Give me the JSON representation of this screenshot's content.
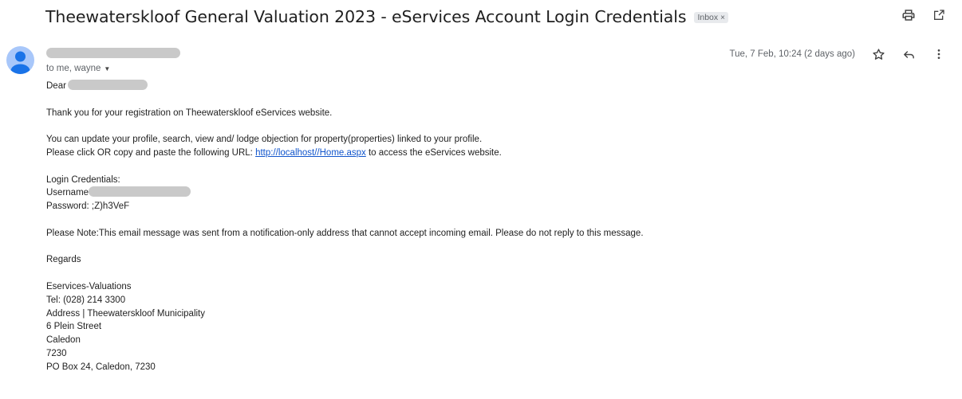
{
  "email": {
    "subject": "Theewaterskloof General Valuation 2023 - eServices Account Login Credentials",
    "label": "Inbox",
    "label_close": "×",
    "to_line": "to me, wayne",
    "date": "Tue, 7 Feb, 10:24 (2 days ago)"
  },
  "body": {
    "greeting": "Dear",
    "para1": "Thank you for your registration on Theewaterskloof eServices website.",
    "para2_line1": "You can update your profile, search, view and/ lodge objection for property(properties) linked to your profile.",
    "para2_line2_prefix": "Please click OR copy and paste the following URL: ",
    "url": "http://localhost//Home.aspx",
    "para2_line2_suffix": " to access the eServices website.",
    "cred_title": "Login Credentials:",
    "username_label": "Username",
    "password_line": "Password: ;Z)h3VeF",
    "note": "Please Note:This email message was sent from a notification-only address that cannot accept incoming email. Please do not reply to this message.",
    "regards": "Regards",
    "signature": [
      "Eservices-Valuations",
      "Tel: (028) 214 3300",
      "Address | Theewaterskloof Municipality",
      "6 Plein Street",
      "Caledon",
      "7230",
      "PO Box 24, Caledon, 7230"
    ]
  },
  "icons": {
    "print": "print-icon",
    "open_new_window": "open-in-new-window-icon",
    "star": "star-icon",
    "reply": "reply-icon",
    "more": "more-vert-icon",
    "caret": "chevron-down-icon",
    "avatar": "default-avatar-icon"
  }
}
